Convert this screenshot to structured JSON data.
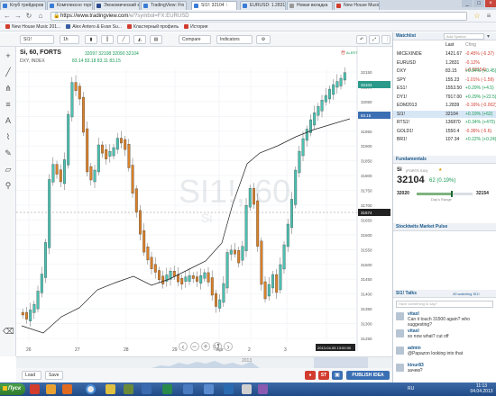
{
  "browser": {
    "tabs": [
      {
        "label": "Клуб трейдеров",
        "color": "#3a7bd5"
      },
      {
        "label": "Комплексно торговл",
        "color": "#3a7bd5"
      },
      {
        "label": "Экономический к",
        "color": "#2b4c8c"
      },
      {
        "label": "TradingView: Fin",
        "color": "#3a7bd5"
      },
      {
        "label": "SI1!: 32104 ↑",
        "color": "#3a7bd5",
        "active": true
      },
      {
        "label": "EURUSD: 1.2831",
        "color": "#3a7bd5"
      },
      {
        "label": "Новая вкладка",
        "color": "#999999"
      },
      {
        "label": "New House Music",
        "color": "#d23c2f"
      }
    ],
    "url_host": "https://www.tradingview.com",
    "url_path": "/e/?symbol=FX:EURUSD",
    "bookmarks": [
      {
        "label": "New House Music 201...",
        "color": "#d23c2f"
      },
      {
        "label": "Alex Antero & Evan Su...",
        "color": "#3a5ba0"
      },
      {
        "label": "Кластерный профиль",
        "color": "#d23c2f"
      },
      {
        "label": "История",
        "color": "#d23c2f"
      }
    ]
  },
  "toolbar": {
    "symbol": "SI1!",
    "interval": "1h",
    "compare": "Compare",
    "indicators": "Indicators"
  },
  "chart": {
    "title": "Si, 60, FORTS",
    "ohlc": "32097  32108  32090  32104",
    "index_label": "DXY, INDEX",
    "index_vals": "83.14  83.18  83.11  83.15",
    "watermark": "SI1!, 60",
    "watermark_sub": "Si",
    "alert": "ALERT",
    "crosshair_price": "31674",
    "current_price": "32104",
    "dxy_tag": "83.15",
    "current_time": "2013-04-05 13:00:00",
    "x_labels": [
      "26",
      "27",
      "28",
      "29",
      "Apr",
      "2",
      "3",
      "4"
    ],
    "y_labels": [
      "32150",
      "32100",
      "32050",
      "32000",
      "31950",
      "31900",
      "31850",
      "31800",
      "31750",
      "31700",
      "31650",
      "31600",
      "31550",
      "31500",
      "31450",
      "31400",
      "31350",
      "31300",
      "31250"
    ],
    "year_label": "2013"
  },
  "bottom": {
    "load": "Load",
    "save": "Save",
    "st_label": "ST",
    "publish": "PUBLISH IDEA"
  },
  "watchlist": {
    "title": "Watchlist",
    "add_placeholder": "Add Symbol",
    "headers": [
      "",
      "Last",
      "Chng"
    ],
    "rows": [
      {
        "sym": "MICEXINDE",
        "last": "1421.67",
        "chg": "-0.45% (-6.37)",
        "dir": "neg"
      },
      {
        "sym": "EURUSD",
        "last": "1.2831",
        "chg": "-0.12% (-0.00154)",
        "dir": "neg"
      },
      {
        "sym": "DXY",
        "last": "83.15",
        "chg": "+0.54% (+0.45)",
        "dir": "pos"
      },
      {
        "sym": "SPY",
        "last": "155.23",
        "chg": "-1.01% (-1.59)",
        "dir": "neg"
      },
      {
        "sym": "ES1!",
        "last": "1553.50",
        "chg": "+0.29% (+4.5)",
        "dir": "pos"
      },
      {
        "sym": "DY1!",
        "last": "7917.00",
        "chg": "+0.29% (+22.5)",
        "dir": "pos"
      },
      {
        "sym": "EDM2013",
        "last": "1.2839",
        "chg": "-0.16% (-0.002)",
        "dir": "neg"
      },
      {
        "sym": "SI1!",
        "last": "32104",
        "chg": "+0.19% (+62)",
        "dir": "pos",
        "sel": true
      },
      {
        "sym": "RTS1!",
        "last": "136870",
        "chg": "+0.34% (+470)",
        "dir": "pos"
      },
      {
        "sym": "GOLD1!",
        "last": "1550.4",
        "chg": "-0.36% (-5.6)",
        "dir": "neg"
      },
      {
        "sym": "BR1!",
        "last": "107.34",
        "chg": "+0.22% (+0.24)",
        "dir": "pos"
      }
    ]
  },
  "fundamentals": {
    "title": "Fundamentals",
    "symbol": "Si",
    "exchange": "(FORTS SI1!)",
    "price": "32104",
    "change": "62 (0.19%)",
    "low": "32020",
    "high": "32154",
    "range_label": "Day's Range",
    "range_fraction": 0.63
  },
  "pulse": {
    "title": "Stocktwits Market Pulse"
  },
  "talks": {
    "title": "SI1! Talks",
    "watching": "49 watching SI1!",
    "placeholder": "Have something to say?",
    "messages": [
      {
        "user": "vitaxl",
        "text": "Can it touch 31500 again? who suggesting?"
      },
      {
        "user": "vitaxl",
        "text": "so now what? cut off"
      },
      {
        "user": "admin",
        "text": "@Papazon looking into that"
      },
      {
        "user": "kinur83",
        "text": "зачем?"
      }
    ]
  },
  "taskbar": {
    "start": "Пуск",
    "lang": "RU",
    "time": "11:13",
    "date": "04.04.2013"
  }
}
